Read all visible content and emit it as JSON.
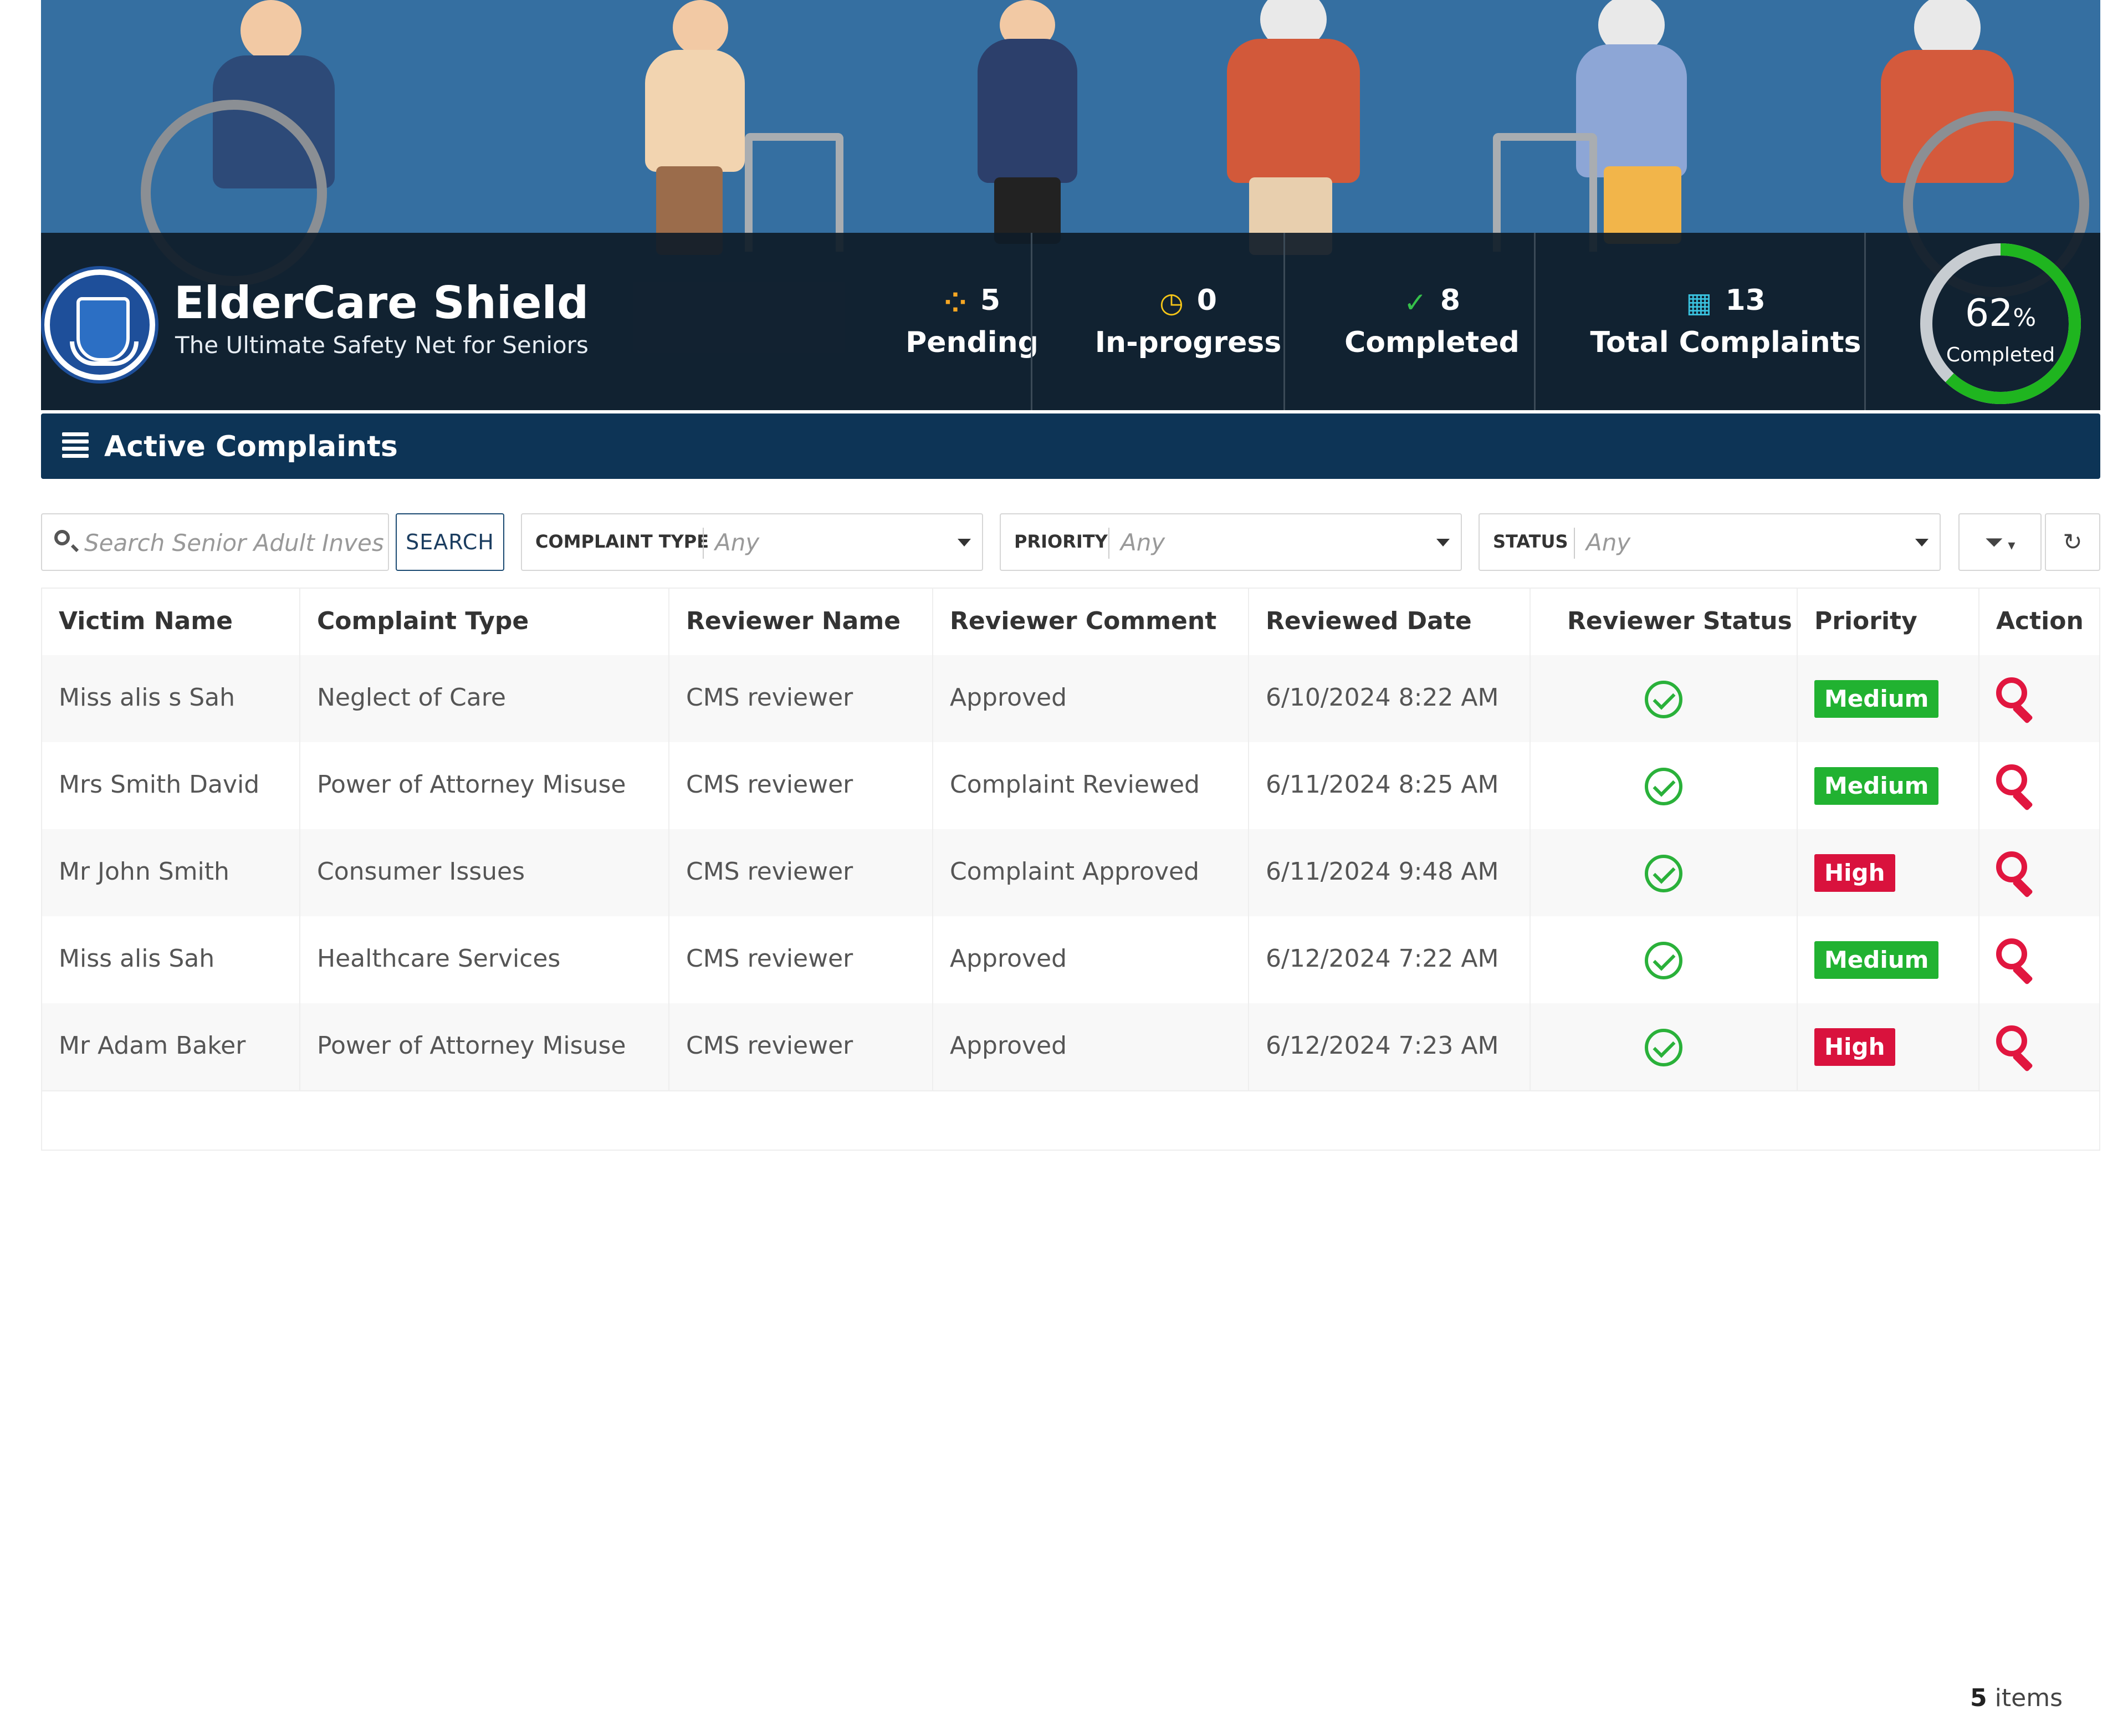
{
  "brand": {
    "title": "ElderCare Shield",
    "subtitle": "The Ultimate Safety Net for Seniors"
  },
  "stats": [
    {
      "icon": "spinner-icon",
      "value": "5",
      "label": "Pending",
      "color": "#f5a623"
    },
    {
      "icon": "clock-icon",
      "value": "0",
      "label": "In-progress",
      "color": "#f5c518"
    },
    {
      "icon": "check-circle-icon",
      "value": "8",
      "label": "Completed",
      "color": "#35c04a"
    },
    {
      "icon": "calendar-icon",
      "value": "13",
      "label": "Total Complaints",
      "color": "#3ac3e0"
    }
  ],
  "progress": {
    "percent": "62",
    "percent_value": 0.62,
    "unit": "%",
    "caption": "Completed",
    "color": "#1fb51f"
  },
  "section": {
    "title": "Active Complaints"
  },
  "filters": {
    "search_placeholder": "Search Senior Adult Investig",
    "search_button": "SEARCH",
    "complaint_type": {
      "label": "COMPLAINT TYPE",
      "value": "Any"
    },
    "priority": {
      "label": "PRIORITY",
      "value": "Any"
    },
    "status": {
      "label": "STATUS",
      "value": "Any"
    }
  },
  "table": {
    "columns": [
      "Victim Name",
      "Complaint Type",
      "Reviewer Name",
      "Reviewer Comment",
      "Reviewed Date",
      "Reviewer Status",
      "Priority",
      "Action"
    ],
    "rows": [
      {
        "victim": "Miss alis s Sah",
        "type": "Neglect of Care",
        "reviewer": "CMS reviewer",
        "comment": "Approved",
        "date": "6/10/2024 8:22 AM",
        "status": "approved",
        "priority": "Medium"
      },
      {
        "victim": "Mrs Smith  David",
        "type": "Power of Attorney Misuse",
        "reviewer": "CMS reviewer",
        "comment": "Complaint Reviewed",
        "date": "6/11/2024 8:25 AM",
        "status": "approved",
        "priority": "Medium"
      },
      {
        "victim": "Mr John  Smith",
        "type": "Consumer Issues",
        "reviewer": "CMS reviewer",
        "comment": "Complaint Approved",
        "date": "6/11/2024 9:48 AM",
        "status": "approved",
        "priority": "High"
      },
      {
        "victim": "Miss alis  Sah",
        "type": "Healthcare Services",
        "reviewer": "CMS reviewer",
        "comment": "Approved",
        "date": "6/12/2024 7:22 AM",
        "status": "approved",
        "priority": "Medium"
      },
      {
        "victim": "Mr Adam  Baker",
        "type": "Power of Attorney Misuse",
        "reviewer": "CMS reviewer",
        "comment": "Approved",
        "date": "6/12/2024 7:23 AM",
        "status": "approved",
        "priority": "High"
      }
    ]
  },
  "pager": {
    "count": "5",
    "suffix": "items"
  },
  "colors": {
    "banner": "#356fa1",
    "header_bar": "#0d3456",
    "medium": "#21b231",
    "high": "#d9123d",
    "check": "#2ab13a",
    "action": "#e1163f"
  }
}
